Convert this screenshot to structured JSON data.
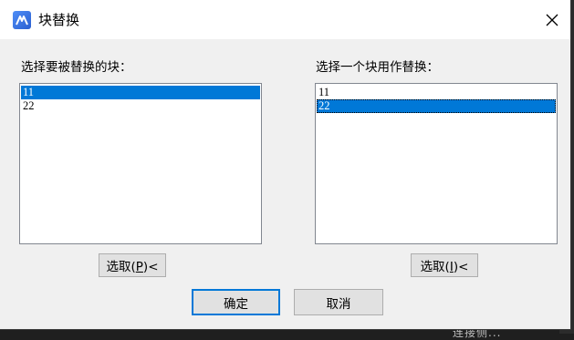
{
  "window": {
    "title": "块替换"
  },
  "left": {
    "label": "选择要被替换的块：",
    "items": [
      {
        "text": "11",
        "selected": true
      },
      {
        "text": "22",
        "selected": false
      }
    ],
    "pick_button": {
      "prefix": "选取(",
      "mnemonic": "P",
      "suffix": ")<"
    }
  },
  "right": {
    "label": "选择一个块用作替换：",
    "items": [
      {
        "text": "11",
        "selected": false
      },
      {
        "text": "22",
        "selected": true
      }
    ],
    "pick_button": {
      "prefix": "选取(",
      "mnemonic": "I",
      "suffix": ")<"
    }
  },
  "footer": {
    "ok_label": "确定",
    "cancel_label": "取消"
  },
  "background": {
    "partial_text": "连接侧..."
  },
  "colors": {
    "selection": "#0078d7",
    "dialog_bg": "#f0f0f0"
  }
}
